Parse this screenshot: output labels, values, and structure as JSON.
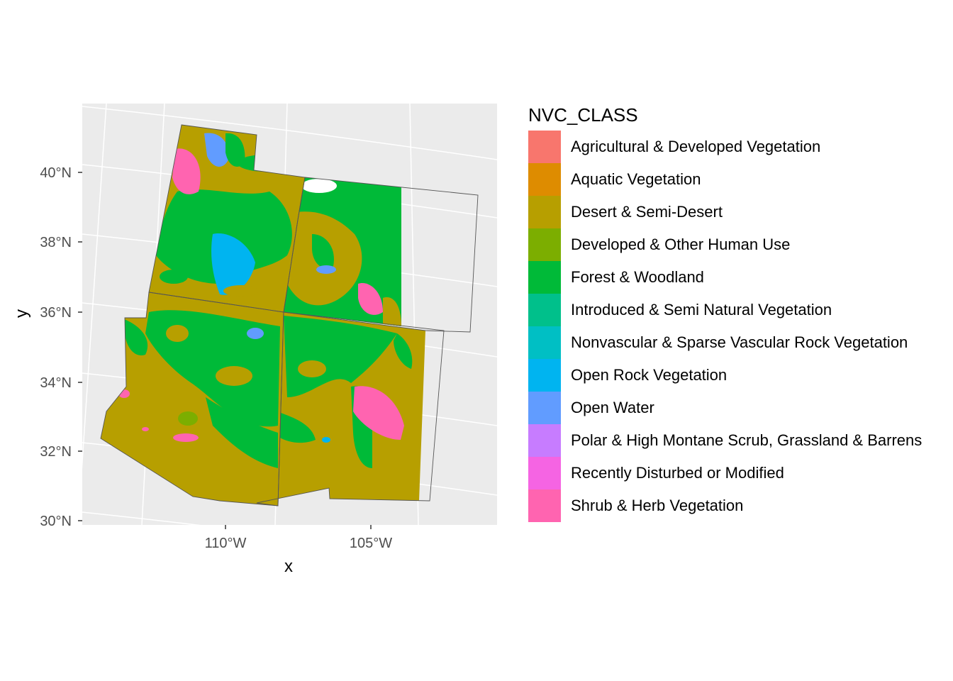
{
  "map": {
    "background": "#ebebeb",
    "grid_color": "#ffffff",
    "x_axis_title": "x",
    "y_axis_title": "y",
    "lat_ticks": [
      "40°N",
      "38°N",
      "36°N",
      "34°N",
      "32°N",
      "30°N"
    ],
    "lon_ticks": [
      "110°W",
      "105°W"
    ]
  },
  "legend": {
    "title": "NVC_CLASS",
    "items": [
      {
        "label": "Agricultural & Developed Vegetation",
        "color": "#F8766D"
      },
      {
        "label": "Aquatic Vegetation",
        "color": "#DE8C00"
      },
      {
        "label": "Desert & Semi-Desert",
        "color": "#B79F00"
      },
      {
        "label": "Developed & Other Human Use",
        "color": "#7CAE00"
      },
      {
        "label": "Forest & Woodland",
        "color": "#00BA38"
      },
      {
        "label": "Introduced & Semi Natural Vegetation",
        "color": "#00C08B"
      },
      {
        "label": "Nonvascular & Sparse Vascular Rock Vegetation",
        "color": "#00BFC4"
      },
      {
        "label": "Open Rock Vegetation",
        "color": "#00B4F0"
      },
      {
        "label": "Open Water",
        "color": "#619CFF"
      },
      {
        "label": "Polar & High Montane Scrub, Grassland & Barrens",
        "color": "#C77CFF"
      },
      {
        "label": "Recently Disturbed or Modified",
        "color": "#F564E3"
      },
      {
        "label": "Shrub & Herb Vegetation",
        "color": "#FF64B0"
      }
    ]
  }
}
